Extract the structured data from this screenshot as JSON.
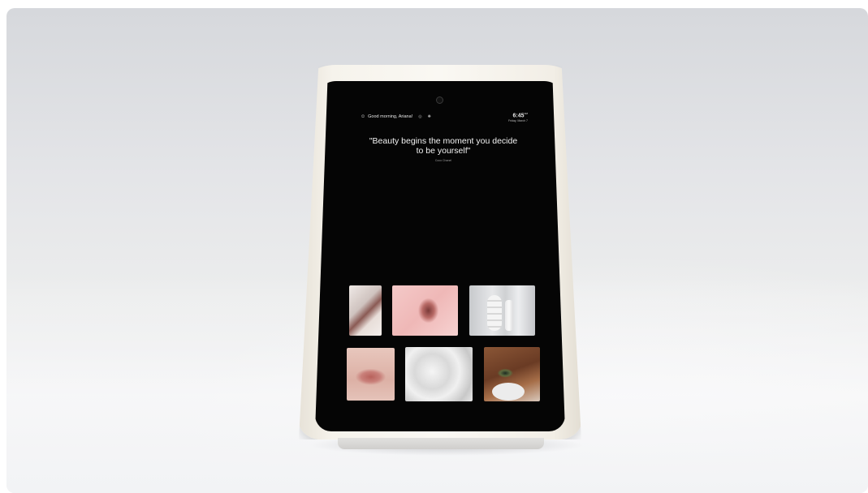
{
  "screen": {
    "greeting": "Good morning, Ariana!",
    "time": "6:45",
    "time_suffix": "AM",
    "date": "Friday, March 7",
    "quote": "\"Beauty begins the moment you decide to be yourself\"",
    "quote_author": "Coco Chanel"
  },
  "icons": {
    "greeting": "person-icon",
    "status_a": "settings-icon",
    "status_b": "sun-icon"
  },
  "gallery": {
    "tiles": [
      "cosmetic-swatch",
      "pink-lips-paper",
      "white-sculptural-objects",
      "lips-closeup",
      "white-cream-texture",
      "eye-with-face-mask"
    ]
  },
  "colors": {
    "screen_bg": "#050505",
    "frame": "#f6f3ec",
    "backdrop": "#e4e5e8"
  }
}
